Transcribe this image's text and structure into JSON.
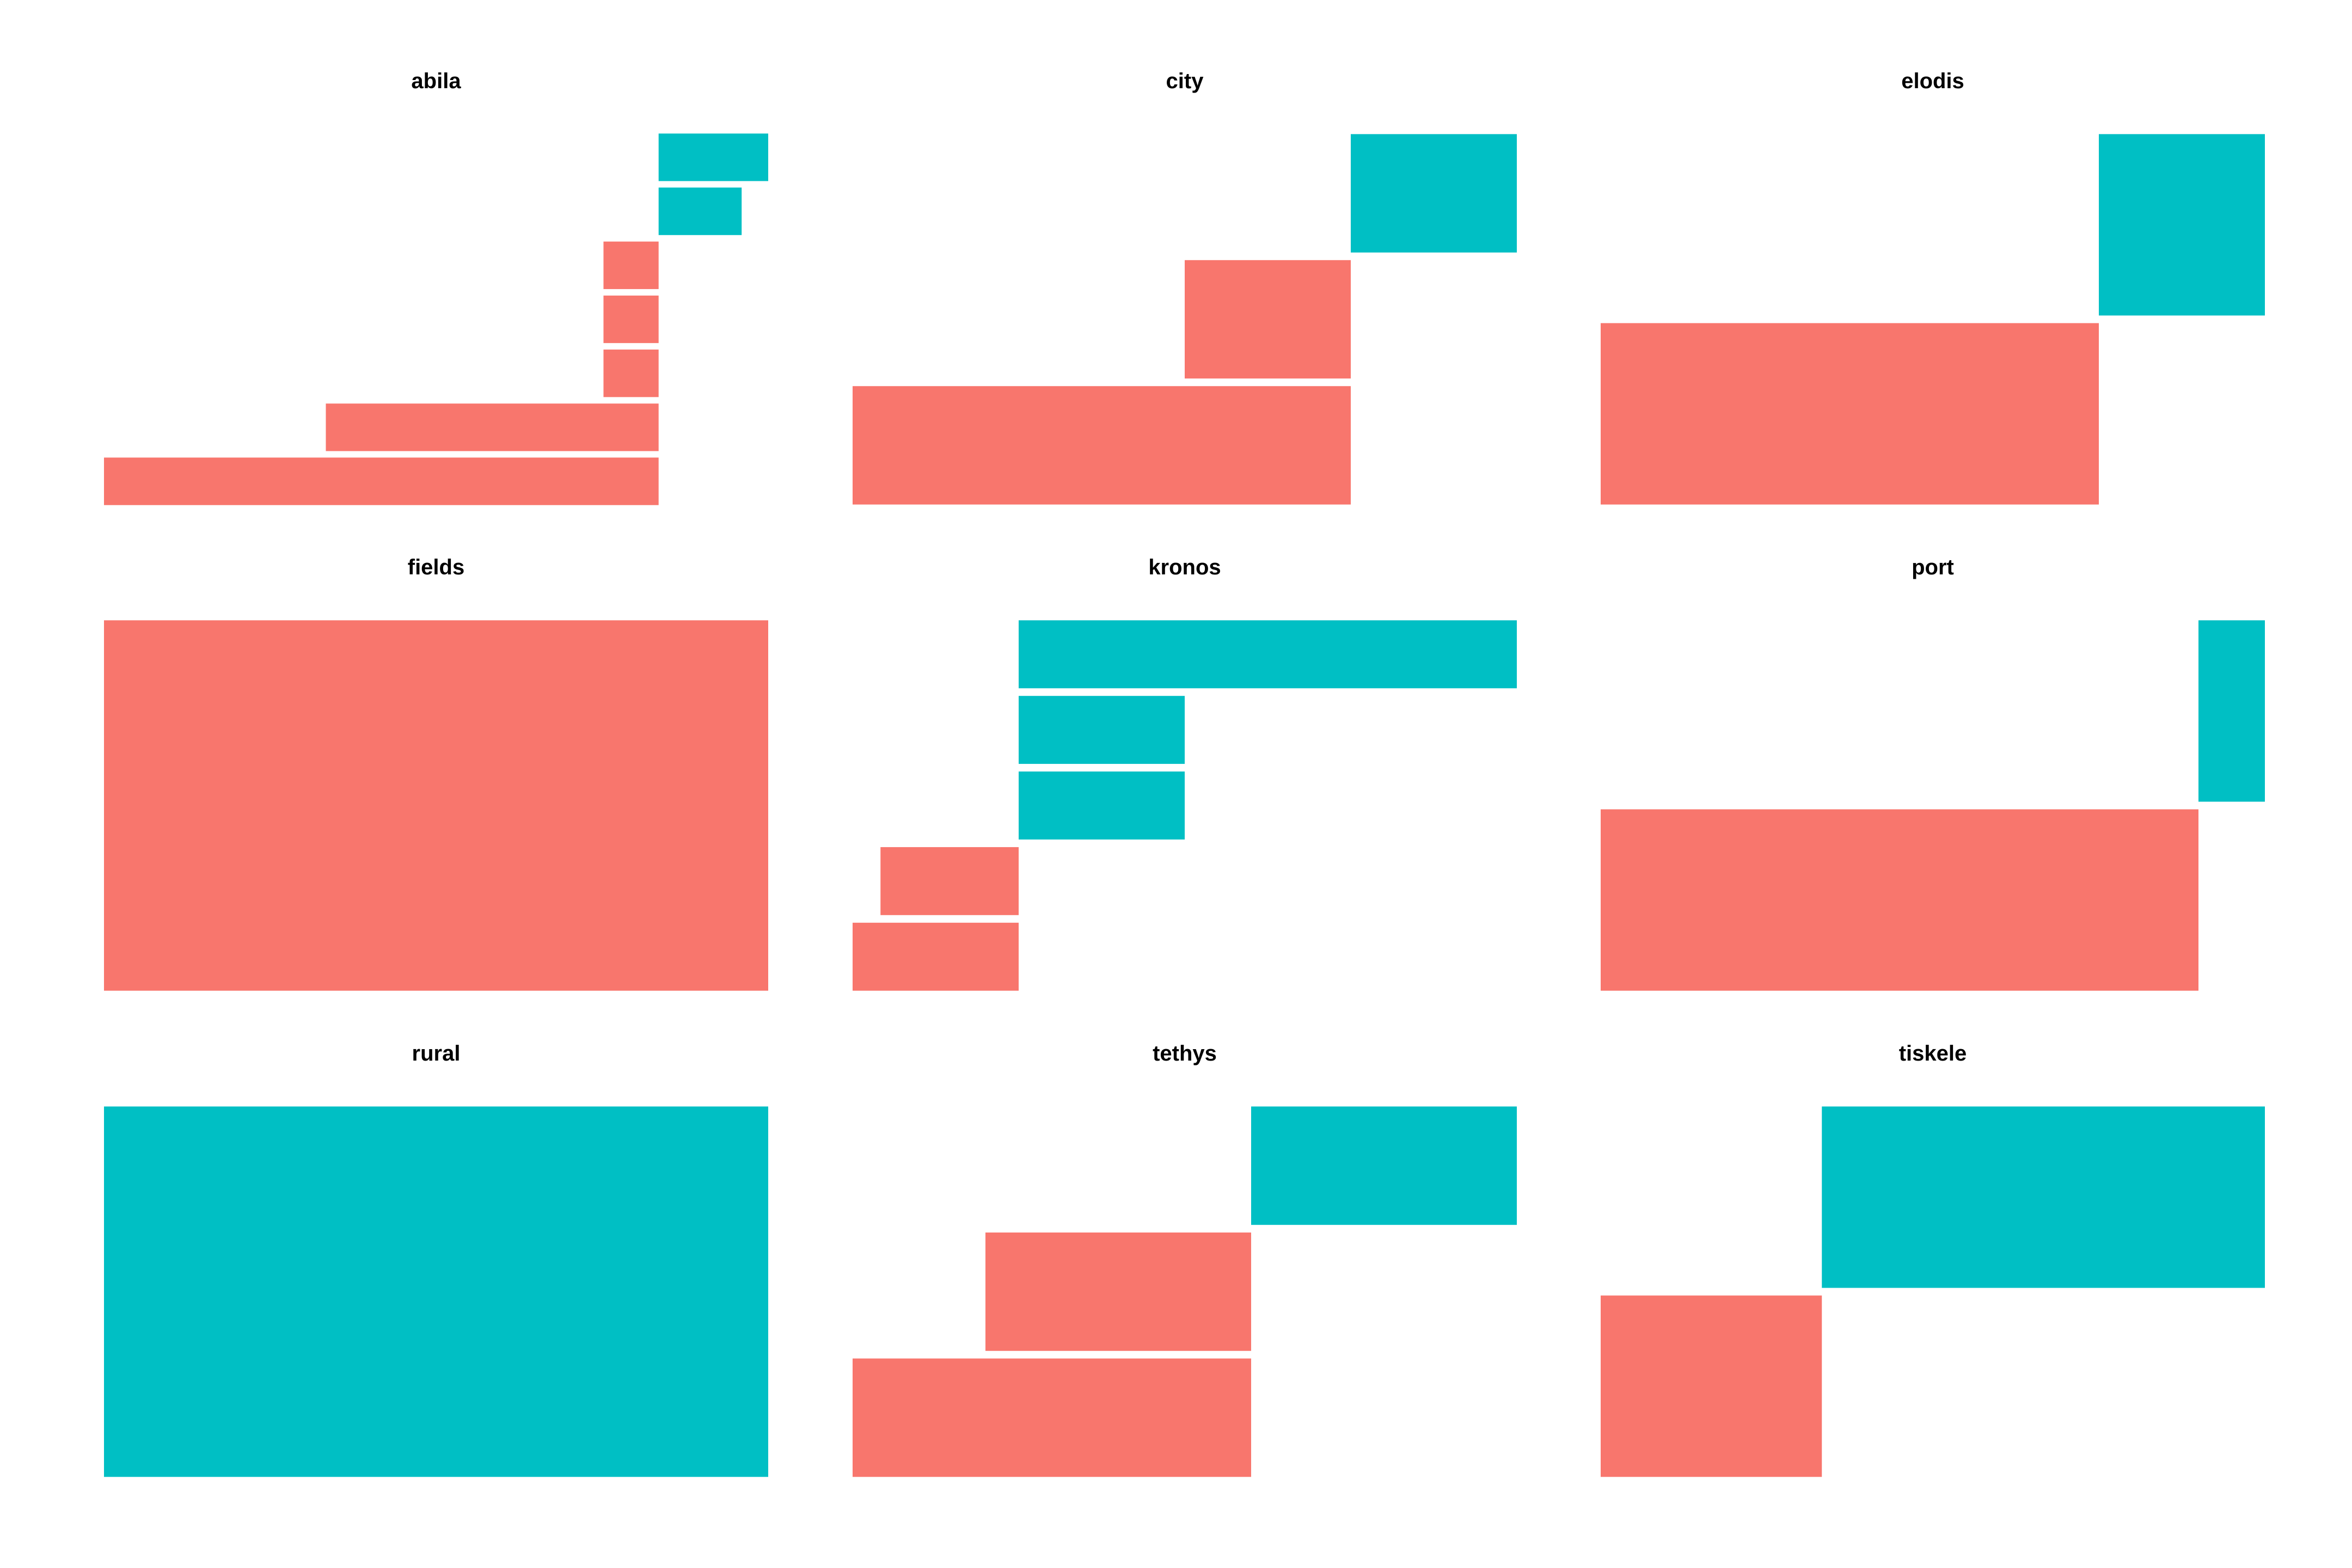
{
  "colors": {
    "salmon": "#F8766D",
    "teal": "#00BFC4"
  },
  "chart_data": {
    "type": "waterfall-facets",
    "layout": {
      "rows": 3,
      "cols": 3
    },
    "panels": [
      {
        "title": "abila",
        "xlim": [
          0,
          100
        ],
        "rects": [
          {
            "x0": 0,
            "x1": 83.5,
            "color": "salmon"
          },
          {
            "x0": 33.4,
            "x1": 83.5,
            "color": "salmon"
          },
          {
            "x0": 75.2,
            "x1": 83.5,
            "color": "salmon"
          },
          {
            "x0": 75.2,
            "x1": 83.5,
            "color": "salmon"
          },
          {
            "x0": 75.2,
            "x1": 83.5,
            "color": "salmon"
          },
          {
            "x0": 83.5,
            "x1": 96.0,
            "color": "teal"
          },
          {
            "x0": 83.5,
            "x1": 100,
            "color": "teal"
          }
        ]
      },
      {
        "title": "city",
        "xlim": [
          0,
          100
        ],
        "rects": [
          {
            "x0": 0,
            "x1": 75.0,
            "color": "salmon"
          },
          {
            "x0": 50.0,
            "x1": 75.0,
            "color": "salmon"
          },
          {
            "x0": 75.0,
            "x1": 100,
            "color": "teal"
          }
        ]
      },
      {
        "title": "elodis",
        "xlim": [
          0,
          100
        ],
        "rects": [
          {
            "x0": 0,
            "x1": 75.0,
            "color": "salmon"
          },
          {
            "x0": 75.0,
            "x1": 100,
            "color": "teal"
          }
        ]
      },
      {
        "title": "fields",
        "xlim": [
          0,
          100
        ],
        "rects": [
          {
            "x0": 0,
            "x1": 100,
            "color": "salmon"
          }
        ]
      },
      {
        "title": "kronos",
        "xlim": [
          0,
          100
        ],
        "rects": [
          {
            "x0": 0,
            "x1": 25.0,
            "color": "salmon"
          },
          {
            "x0": 4.2,
            "x1": 25.0,
            "color": "salmon"
          },
          {
            "x0": 25.0,
            "x1": 50.0,
            "color": "teal"
          },
          {
            "x0": 25.0,
            "x1": 50.0,
            "color": "teal"
          },
          {
            "x0": 25.0,
            "x1": 100,
            "color": "teal"
          }
        ]
      },
      {
        "title": "port",
        "xlim": [
          0,
          100
        ],
        "rects": [
          {
            "x0": 0,
            "x1": 90.0,
            "color": "salmon"
          },
          {
            "x0": 90.0,
            "x1": 100,
            "color": "teal"
          }
        ]
      },
      {
        "title": "rural",
        "xlim": [
          0,
          100
        ],
        "rects": [
          {
            "x0": 0,
            "x1": 100,
            "color": "teal"
          }
        ]
      },
      {
        "title": "tethys",
        "xlim": [
          0,
          100
        ],
        "rects": [
          {
            "x0": 0,
            "x1": 60.0,
            "color": "salmon"
          },
          {
            "x0": 20.0,
            "x1": 60.0,
            "color": "salmon"
          },
          {
            "x0": 60.0,
            "x1": 100,
            "color": "teal"
          }
        ]
      },
      {
        "title": "tiskele",
        "xlim": [
          0,
          100
        ],
        "rects": [
          {
            "x0": 0,
            "x1": 33.3,
            "color": "salmon"
          },
          {
            "x0": 33.3,
            "x1": 100,
            "color": "teal"
          }
        ]
      }
    ]
  }
}
